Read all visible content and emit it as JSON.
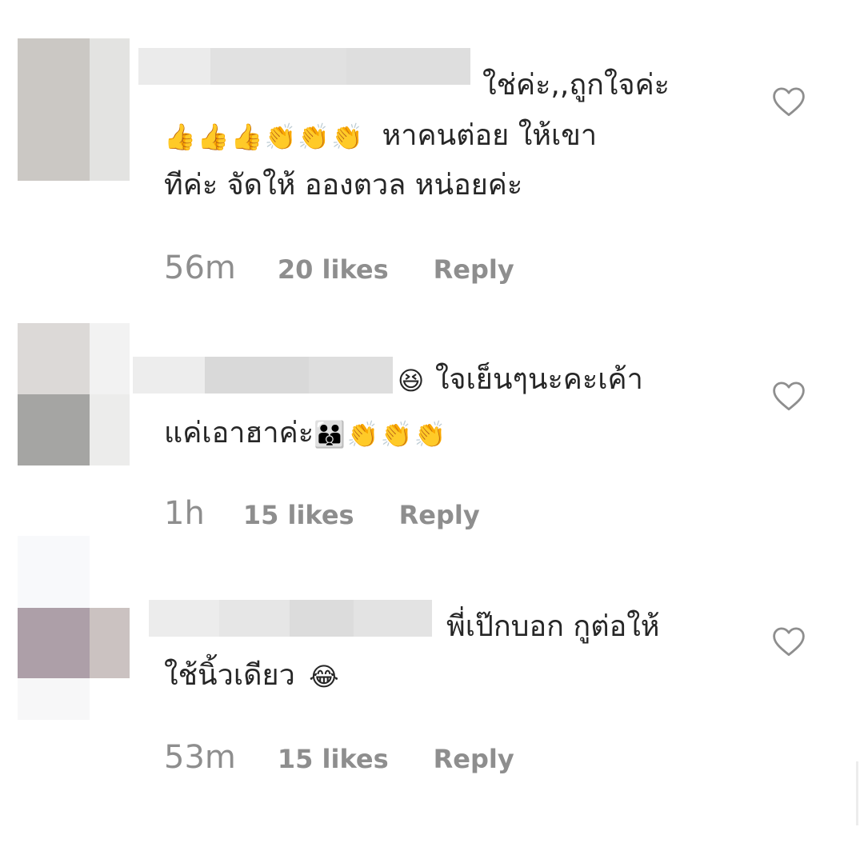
{
  "comments": [
    {
      "text_line1": "ใช่ค่ะ,,ถูกใจค่ะ",
      "emojis_line2": [
        "👍",
        "👍",
        "👍",
        "👏",
        "👏",
        "👏"
      ],
      "text_line2": "หาคนต่อย ให้เขา",
      "text_line3": "ทีค่ะ จัดให้ อองตวล หน่อยค่ะ",
      "time": "56m",
      "likes": "20 likes",
      "reply": "Reply",
      "icons": {
        "like": "heart-outline-icon"
      }
    },
    {
      "emoji_line1": "😆",
      "text_line1": "ใจเย็นๆนะคะเค้า",
      "text_line2": "แค่เอาฮาค่ะ",
      "emojis_line2": [
        "👪",
        "👏",
        "👏",
        "👏"
      ],
      "time": "1h",
      "likes": "15 likes",
      "reply": "Reply",
      "icons": {
        "like": "heart-outline-icon"
      }
    },
    {
      "text_line1": "พี่เป๊กบอก กูต่อให้",
      "text_line2": "ใช้นิ้วเดียว",
      "emoji_line2": "😂",
      "time": "53m",
      "likes": "15 likes",
      "reply": "Reply",
      "icons": {
        "like": "heart-outline-icon"
      }
    }
  ],
  "colors": {
    "text": "#262626",
    "meta": "#8e8e8e",
    "heart_stroke": "#8e8e8e"
  }
}
